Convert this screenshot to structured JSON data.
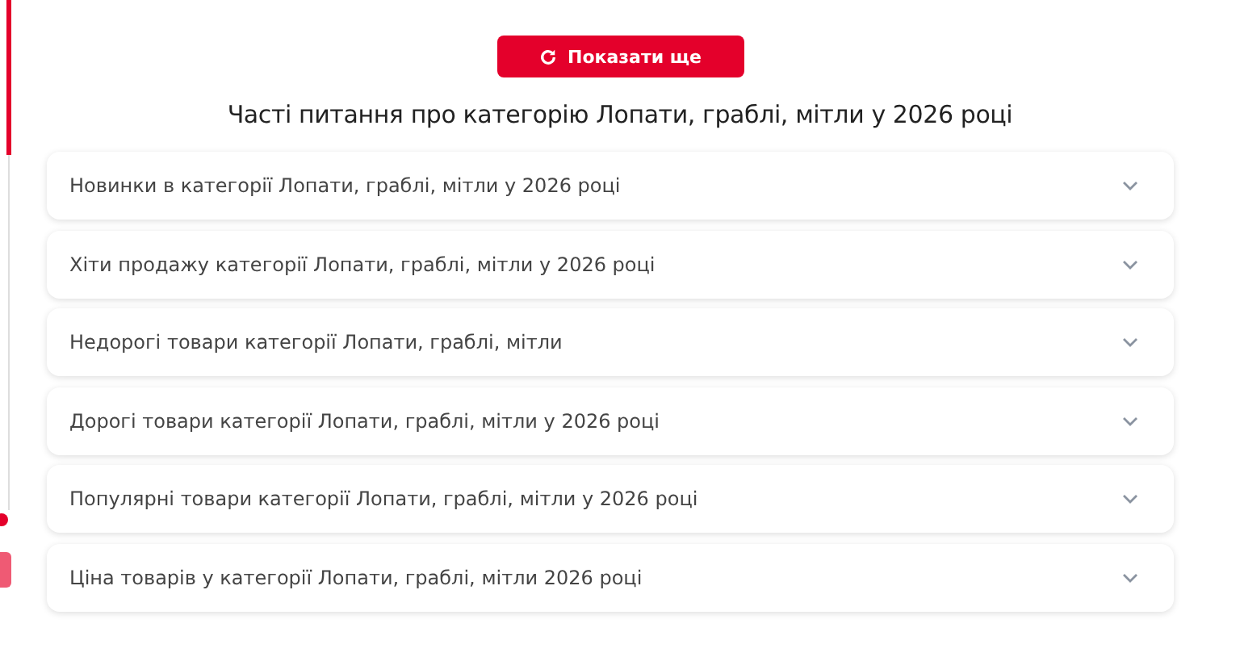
{
  "show_more_button": {
    "label": "Показати ще"
  },
  "faq": {
    "title": "Часті питання про категорію Лопати, граблі, мітли у 2026 році",
    "items": [
      {
        "question": "Новинки в категорії Лопати, граблі, мітли у 2026 році",
        "expanded": false
      },
      {
        "question": "Хіти продажу категорії Лопати, граблі, мітли у 2026 році",
        "expanded": false
      },
      {
        "question": "Недорогі товари категорії Лопати, граблі, мітли",
        "expanded": false
      },
      {
        "question": "Дорогі товари категорії Лопати, граблі, мітли у 2026 році",
        "expanded": false
      },
      {
        "question": "Популярні товари категорії Лопати, граблі, мітли у 2026 році",
        "expanded": false
      },
      {
        "question": "Ціна товарів у категорії Лопати, граблі, мітли 2026 році",
        "expanded": false
      }
    ]
  }
}
